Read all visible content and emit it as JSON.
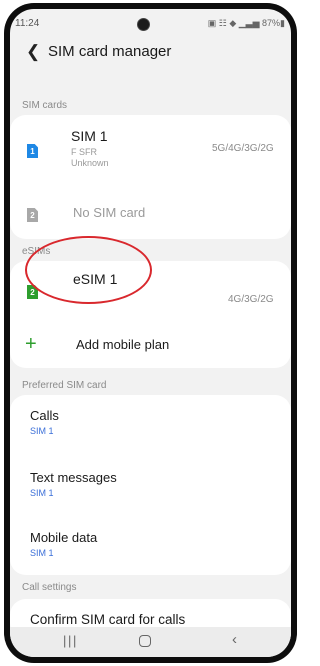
{
  "status_bar": {
    "time": "11:24",
    "battery": "87%"
  },
  "header": {
    "back_icon": "chevron-left-icon",
    "title": "SIM card manager"
  },
  "sections": {
    "sim_cards": "SIM cards",
    "esims": "eSIMs",
    "preferred": "Preferred SIM card",
    "call_settings": "Call settings"
  },
  "sim_cards": [
    {
      "name": "SIM 1",
      "carrier": "F SFR",
      "number": "Unknown",
      "network": "5G/4G/3G/2G",
      "badge": "1",
      "color": "#1e88e5"
    },
    {
      "name": "No SIM card",
      "badge": "2",
      "color": "#9e9e9e"
    }
  ],
  "esims": [
    {
      "name": "eSIM 1",
      "network": "4G/3G/2G",
      "badge": "2",
      "color": "#2e9e2e"
    }
  ],
  "add_plan": {
    "icon": "plus-icon",
    "label": "Add mobile plan",
    "color": "#2e9e2e"
  },
  "preferred": [
    {
      "label": "Calls",
      "value": "SIM 1"
    },
    {
      "label": "Text messages",
      "value": "SIM 1"
    },
    {
      "label": "Mobile data",
      "value": "SIM 1"
    }
  ],
  "call_settings": {
    "confirm_label": "Confirm SIM card for calls"
  },
  "nav_bar": {
    "recents_icon": "recents-icon",
    "home_icon": "home-icon",
    "back_icon": "back-icon"
  },
  "accent_colors": {
    "highlight_circle": "#d9282d",
    "link_blue": "#3b6fd8"
  }
}
